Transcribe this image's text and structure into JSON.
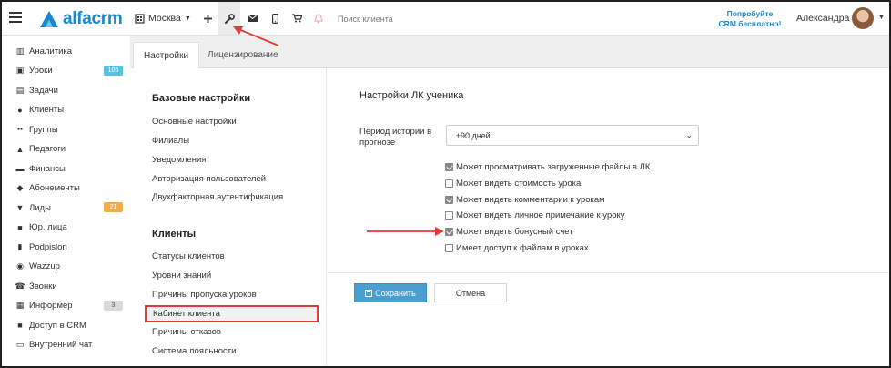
{
  "brand": {
    "logo_text": "alfacrm",
    "accent": "#1a8ad0"
  },
  "topbar": {
    "city": "Москва",
    "icons": [
      "plus-icon",
      "wrench-icon",
      "mail-icon",
      "phone-icon",
      "cart-icon",
      "bell-icon"
    ],
    "search_placeholder": "Поиск клиента",
    "promo_line1": "Попробуйте",
    "promo_line2": "CRM бесплатно!",
    "username": "Александра"
  },
  "sidebar": {
    "items": [
      {
        "label": "Аналитика",
        "icon": "chart-icon"
      },
      {
        "label": "Уроки",
        "icon": "calendar-icon",
        "badge": "106",
        "badge_color": "#5bc0de"
      },
      {
        "label": "Задачи",
        "icon": "tasks-icon"
      },
      {
        "label": "Клиенты",
        "icon": "user-icon"
      },
      {
        "label": "Группы",
        "icon": "users-icon"
      },
      {
        "label": "Педагоги",
        "icon": "graduation-icon"
      },
      {
        "label": "Финансы",
        "icon": "money-icon"
      },
      {
        "label": "Абонементы",
        "icon": "tag-icon"
      },
      {
        "label": "Лиды",
        "icon": "funnel-icon",
        "badge": "21",
        "badge_color": "#f0ad4e"
      },
      {
        "label": "Юр. лица",
        "icon": "briefcase-icon"
      },
      {
        "label": "Podpislon",
        "icon": "document-icon"
      },
      {
        "label": "Wazzup",
        "icon": "whatsapp-icon"
      },
      {
        "label": "Звонки",
        "icon": "phone-icon"
      },
      {
        "label": "Информер",
        "icon": "informer-icon",
        "badge": "3",
        "badge_color": "#d9d9d9"
      },
      {
        "label": "Доступ в CRM",
        "icon": "lock-icon"
      },
      {
        "label": "Внутренний чат",
        "icon": "chat-icon"
      }
    ]
  },
  "tabs": [
    {
      "label": "Настройки"
    },
    {
      "label": "Лицензирование"
    }
  ],
  "settings_menu": {
    "basic_heading": "Базовые настройки",
    "basic_links": [
      "Основные настройки",
      "Филиалы",
      "Уведомления",
      "Авторизация пользователей",
      "Двухфакторная аутентификация"
    ],
    "clients_heading": "Клиенты",
    "clients_links": [
      "Статусы клиентов",
      "Уровни знаний",
      "Причины пропуска уроков",
      "Кабинет клиента",
      "Причины отказов",
      "Система лояльности"
    ],
    "active_link": "Кабинет клиента"
  },
  "panel": {
    "title": "Настройки ЛК ученика",
    "history_label": "Период истории в прогнозе",
    "history_value": "±90 дней",
    "checkboxes": [
      {
        "label": "Может просматривать загруженные файлы в ЛК",
        "checked": true
      },
      {
        "label": "Может видеть стоимость урока",
        "checked": false
      },
      {
        "label": "Может видеть комментарии к урокам",
        "checked": true
      },
      {
        "label": "Может видеть личное примечание к уроку",
        "checked": false
      },
      {
        "label": "Может видеть бонусный счет",
        "checked": true
      },
      {
        "label": "Имеет доступ к файлам в уроках",
        "checked": false
      }
    ],
    "save_label": "Сохранить",
    "cancel_label": "Отмена"
  },
  "annotation_color": "#e23b3b"
}
